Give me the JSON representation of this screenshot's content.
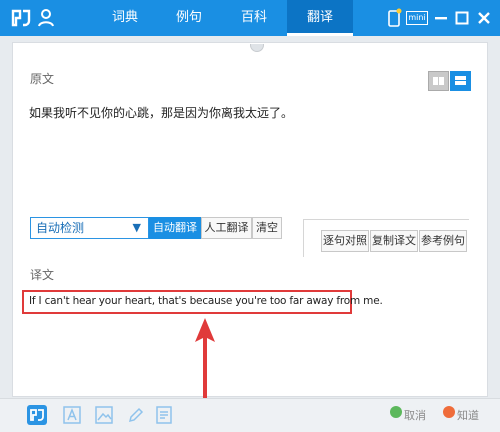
{
  "titlebar": {
    "tabs": [
      {
        "label": "词典"
      },
      {
        "label": "例句"
      },
      {
        "label": "百科"
      },
      {
        "label": "翻译"
      }
    ],
    "mini_label": "mini"
  },
  "source": {
    "label": "原文",
    "text": "如果我听不见你的心跳，那是因为你离我太远了。"
  },
  "toolbar": {
    "lang_select_value": "自动检测",
    "auto_translate_label": "自动翻译",
    "human_translate_label": "人工翻译",
    "clear_label": "清空",
    "compare_label": "逐句对照",
    "copy_label": "复制译文",
    "examples_label": "参考例句"
  },
  "translation": {
    "label": "译文",
    "text": "If I can't hear your heart, that's because you're too far away from me."
  },
  "bottombar": {
    "left_text": "取消",
    "right_text": "知道"
  },
  "colors": {
    "accent": "#1a8fe3",
    "highlight_border": "#e03a3a"
  }
}
